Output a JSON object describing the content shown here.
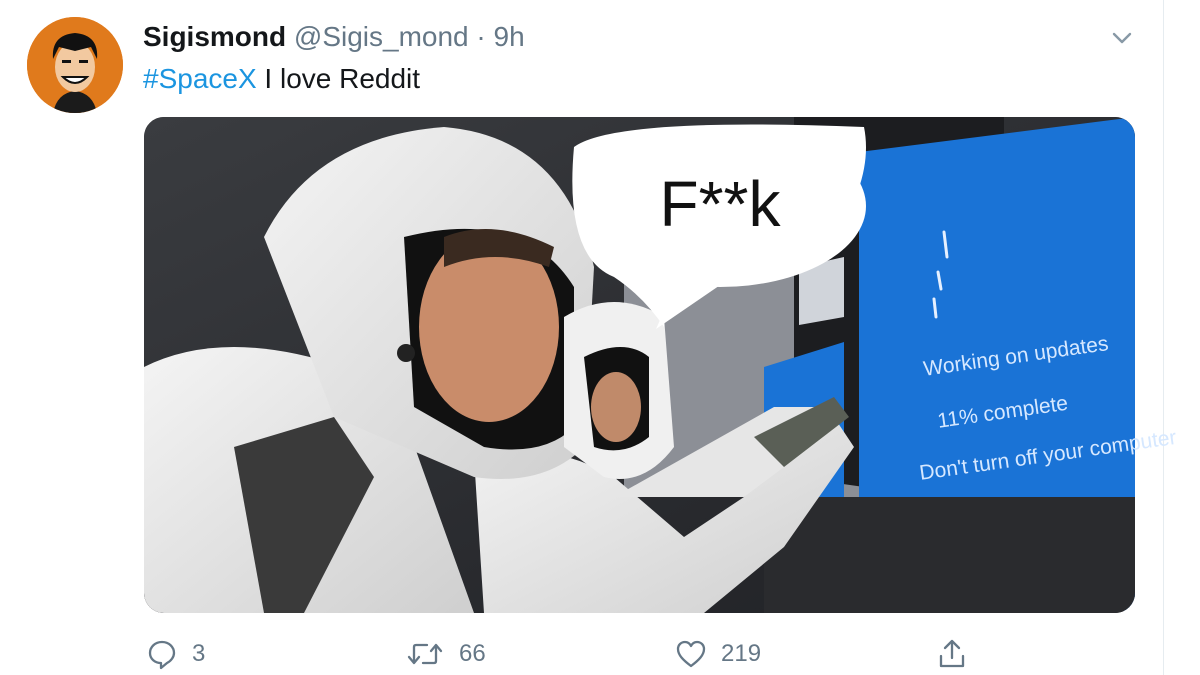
{
  "tweet": {
    "author_name": "Sigismond",
    "handle": "@Sigis_mond",
    "separator": "·",
    "timestamp": "9h",
    "hashtag": "#SpaceX",
    "text": " I love Reddit"
  },
  "media": {
    "bubble_text": "F**k",
    "screen_line_1": "Working on updates",
    "screen_line_2": "11% complete",
    "screen_line_3": "Don't turn off your computer"
  },
  "actions": {
    "reply_count": "3",
    "retweet_count": "66",
    "like_count": "219"
  },
  "colors": {
    "link": "#1b95e0",
    "muted": "#657786",
    "screen_blue": "#1a73d6"
  },
  "icons": [
    "caret-down-icon",
    "reply-icon",
    "retweet-icon",
    "heart-icon",
    "share-icon"
  ]
}
